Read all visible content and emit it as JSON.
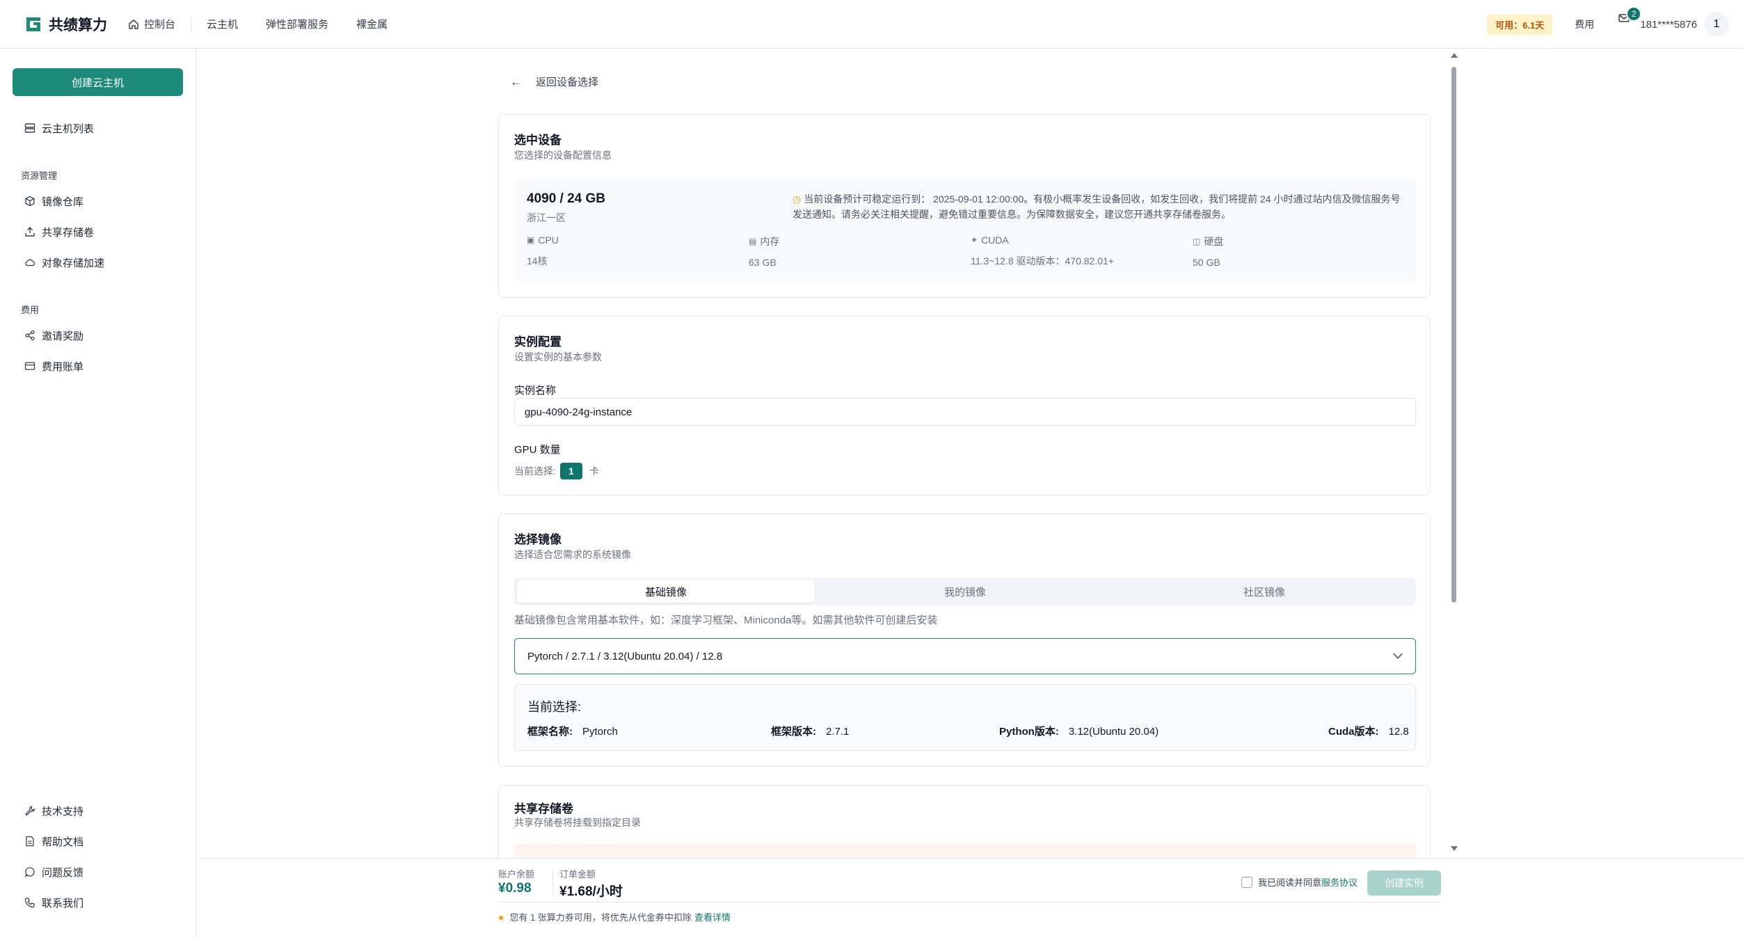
{
  "brand": {
    "name": "共绩算力",
    "color": "#1e8a7a"
  },
  "nav": {
    "items": [
      {
        "label": "控制台",
        "icon": "home-icon"
      },
      {
        "label": "云主机"
      },
      {
        "label": "弹性部署服务"
      },
      {
        "label": "裸金属"
      }
    ],
    "available": "可用：6.1天",
    "fee": "费用",
    "mail_count": "2",
    "user_phone": "181****5876",
    "avatar_text": "1"
  },
  "sidebar": {
    "create_button": "创建云主机",
    "list_item": "云主机列表",
    "group_resources": "资源管理",
    "resources": [
      "镜像仓库",
      "共享存储卷",
      "对象存储加速"
    ],
    "group_fees": "费用",
    "fees": [
      "邀请奖励",
      "费用账单"
    ],
    "bottom": [
      "技术支持",
      "帮助文档",
      "问题反馈",
      "联系我们"
    ]
  },
  "back": "返回设备选择",
  "device": {
    "title": "选中设备",
    "subtitle": "您选择的设备配置信息",
    "name": "4090 / 24 GB",
    "region": "浙江一区",
    "notice": "当前设备预计可稳定运行到： 2025-09-01 12:00:00。有极小概率发生设备回收，如发生回收，我们将提前 24 小时通过站内信及微信服务号发送通知。请务必关注相关提醒，避免错过重要信息。为保障数据安全，建议您开通共享存储卷服务。",
    "specs": [
      {
        "label": "CPU",
        "value": "14核",
        "icon": "cpu-icon"
      },
      {
        "label": "内存",
        "value": "63 GB",
        "icon": "memory-icon"
      },
      {
        "label": "CUDA",
        "value": "11.3~12.8 驱动版本：470.82.01+",
        "icon": "cuda-icon"
      },
      {
        "label": "硬盘",
        "value": "50 GB",
        "icon": "disk-icon"
      }
    ]
  },
  "instance": {
    "title": "实例配置",
    "subtitle": "设置实例的基本参数",
    "name_label": "实例名称",
    "name_value": "gpu-4090-24g-instance",
    "gpu_label": "GPU 数量",
    "gpu_current_prefix": "当前选择:",
    "gpu_count": "1",
    "gpu_unit": "卡"
  },
  "image": {
    "title": "选择镜像",
    "subtitle": "选择适合您需求的系统镜像",
    "tabs": [
      "基础镜像",
      "我的镜像",
      "社区镜像"
    ],
    "active_tab": 0,
    "hint": "基础镜像包含常用基本软件，如：深度学习框架、Miniconda等。如需其他软件可创建后安装",
    "selected": "Pytorch / 2.7.1 / 3.12(Ubuntu 20.04) / 12.8",
    "current_title": "当前选择:",
    "details": [
      {
        "label": "框架名称:",
        "value": "Pytorch"
      },
      {
        "label": "框架版本:",
        "value": "2.7.1"
      },
      {
        "label": "Python版本:",
        "value": "3.12(Ubuntu 20.04)"
      },
      {
        "label": "Cuda版本:",
        "value": "12.8"
      }
    ]
  },
  "storage": {
    "title": "共享存储卷",
    "subtitle": "共享存储卷将挂载到指定目录"
  },
  "footer": {
    "balance_label": "账户余额",
    "balance": "¥0.98",
    "order_label": "订单金额",
    "order": "¥1.68/小时",
    "coupon_text": "您有 1 张算力券可用，将优先从代金券中扣除",
    "coupon_link": "查看详情",
    "agree_text": "我已阅读并同意",
    "agree_link": "服务协议",
    "create_button": "创建实例"
  }
}
